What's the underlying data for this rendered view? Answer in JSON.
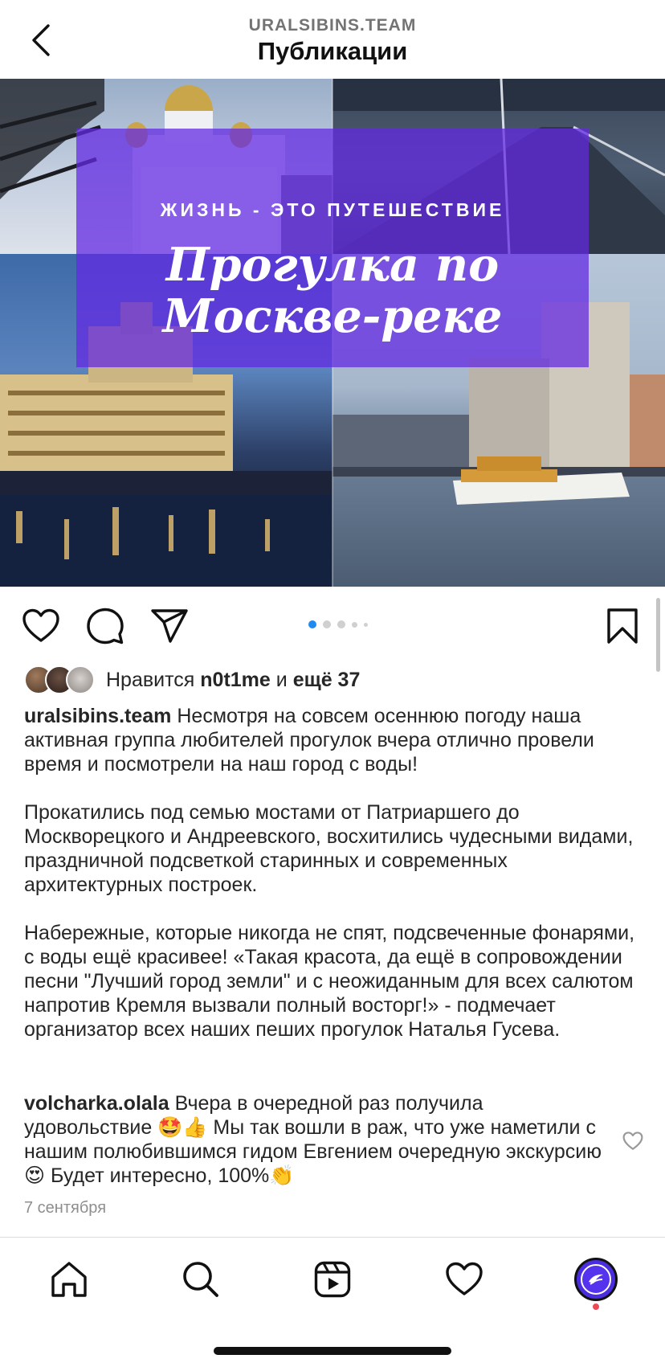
{
  "header": {
    "account": "URALSIBINS.TEAM",
    "title": "Публикации"
  },
  "post_image": {
    "overlay_small": "ЖИЗНЬ - ЭТО ПУТЕШЕСТВИЕ",
    "overlay_big": "Прогулка по Москве-реке",
    "overlay_color": "#6228e2",
    "carousel": {
      "count": 5,
      "active_index": 0
    }
  },
  "icons": {
    "back": "chevron-left-icon",
    "like": "heart-icon",
    "comment": "comment-bubble-icon",
    "share": "paper-plane-icon",
    "save": "bookmark-icon"
  },
  "likes": {
    "prefix": "Нравится",
    "user": "n0t1me",
    "joiner": "и",
    "others": "ещё 37"
  },
  "caption": {
    "username": "uralsibins.team",
    "paragraphs": [
      "Несмотря на совсем осеннюю погоду наша активная группа любителей прогулок вчера отлично провели время и посмотрели на наш город с воды!",
      "Прокатились под семью мостами от Патриаршего до Москворецкого и Андреевского, восхитились чудесными видами, праздничной подсветкой старинных и современных архитектурных построек.",
      "Набережные, которые никогда не спят, подсвеченные фонарями, с воды ещё красивее! «Такая красота, да ещё в сопровождении песни \"Лучший город земли\" и с неожиданным для всех салютом напротив Кремля вызвали полный восторг!» - подмечает организатор всех наших пеших прогулок Наталья Гусева."
    ]
  },
  "comment": {
    "username": "volcharka.olala",
    "text": "Вчера в очередной раз получила удовольствие 🤩👍 Мы так вошли в раж, что уже наметили с нашим полюбившимся гидом Евгением очередную экскурсию😍 Будет интересно, 100%👏"
  },
  "date": "7 сентября",
  "nav": {
    "items": [
      "home-icon",
      "search-icon",
      "reels-icon",
      "activity-heart-icon",
      "profile-avatar"
    ],
    "accent": "#ed4956"
  }
}
